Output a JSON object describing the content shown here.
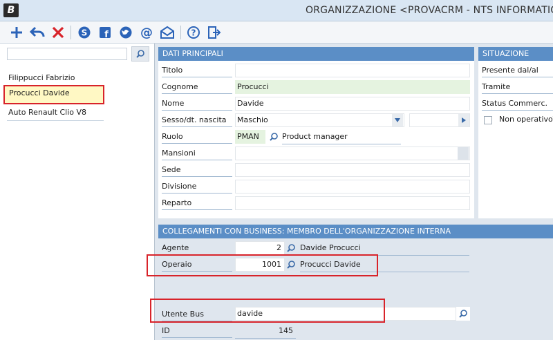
{
  "window": {
    "title": "ORGANIZZAZIONE <PROVACRM - NTS INFORMATICA",
    "logo_letter": "B"
  },
  "toolbar": {
    "buttons": [
      "add-icon",
      "undo-icon",
      "delete-icon",
      "skype-icon",
      "facebook-icon",
      "twitter-icon",
      "email-at-icon",
      "mail-open-icon",
      "help-icon",
      "exit-icon"
    ]
  },
  "sidebar": {
    "search_value": "",
    "items": [
      {
        "label": "Filippucci Fabrizio"
      },
      {
        "label": "Procucci Davide"
      },
      {
        "label": "Auto Renault Clio V8"
      }
    ]
  },
  "main": {
    "header": "DATI PRINCIPALI",
    "fields": {
      "titolo": {
        "label": "Titolo",
        "value": ""
      },
      "cognome": {
        "label": "Cognome",
        "value": "Procucci"
      },
      "nome": {
        "label": "Nome",
        "value": "Davide"
      },
      "sesso": {
        "label": "Sesso/dt. nascita",
        "value": "Maschio",
        "date": ""
      },
      "ruolo": {
        "label": "Ruolo",
        "code": "PMAN",
        "description": "Product manager"
      },
      "mansioni": {
        "label": "Mansioni",
        "value": ""
      },
      "sede": {
        "label": "Sede",
        "value": ""
      },
      "divisione": {
        "label": "Divisione",
        "value": ""
      },
      "reparto": {
        "label": "Reparto",
        "value": ""
      }
    }
  },
  "situazione": {
    "header": "SITUAZIONE",
    "presente": "Presente dal/al",
    "tramite": "Tramite",
    "status": "Status Commerc.",
    "non_operativo": "Non operativo\\C"
  },
  "collegamenti": {
    "header": "COLLEGAMENTI CON BUSINESS: MEMBRO DELL'ORGANIZZAZIONE INTERNA",
    "agente": {
      "label": "Agente",
      "value": "2",
      "name": "Davide Procucci"
    },
    "operaio": {
      "label": "Operaio",
      "value": "1001",
      "name": "Procucci Davide"
    },
    "utente": {
      "label": "Utente Bus",
      "value": "davide"
    },
    "id": {
      "label": "ID",
      "value": "145"
    }
  },
  "colors": {
    "header_blue": "#5b8ec6",
    "highlight_red": "#d8232a",
    "selected_yellow": "#fff8c4",
    "field_green": "#e5f3e0"
  }
}
